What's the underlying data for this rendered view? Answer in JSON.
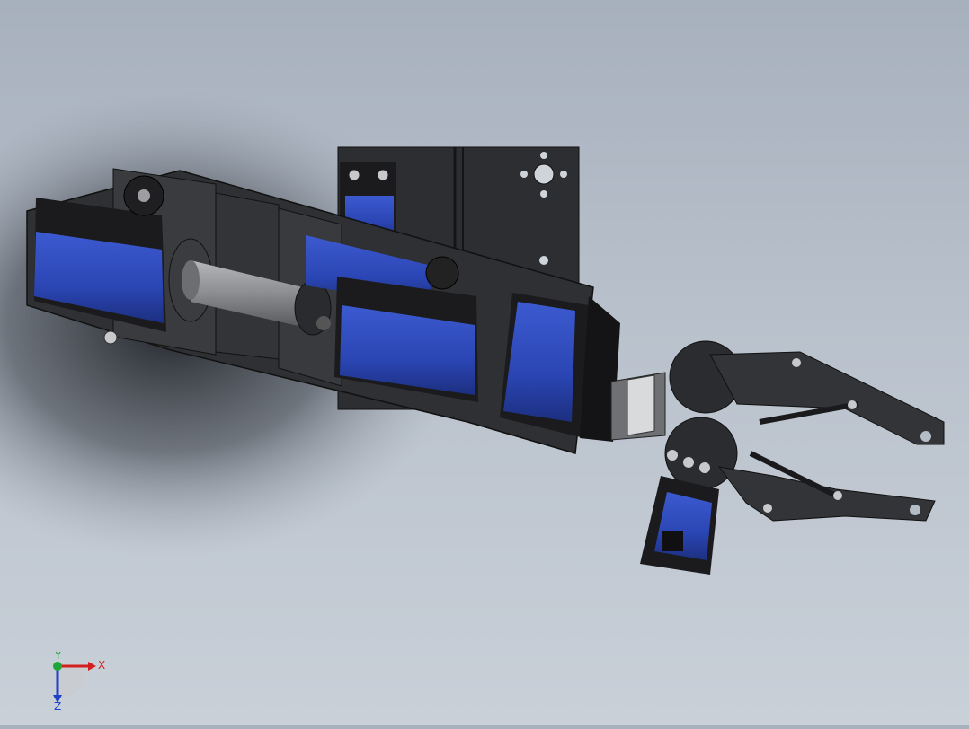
{
  "viewport": {
    "description_colors": {
      "background_top": "#a7b0bd",
      "background_bottom": "#c9d0d8",
      "servo_blue": "#2b46b4",
      "servo_black": "#1b1b1d",
      "bracket_dark": "#3a3b3e",
      "shaft_gray": "#8e9094"
    }
  },
  "triad": {
    "x_label": "X",
    "y_label": "Y",
    "z_label": "Z",
    "x_color": "#d21f1f",
    "y_color": "#1fa63a",
    "z_color": "#2040c8"
  }
}
